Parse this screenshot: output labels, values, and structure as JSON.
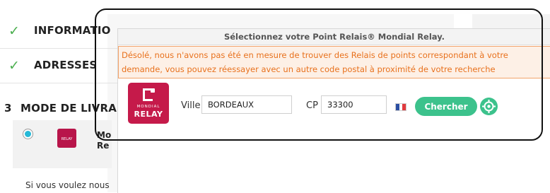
{
  "steps": [
    {
      "title": "INFORMATIO",
      "done": true
    },
    {
      "title": "ADRESSES",
      "done": true
    },
    {
      "number": "3",
      "title": "MODE DE LIVRA"
    }
  ],
  "carrier": {
    "name_line1": "Mo",
    "name_line2": "Re",
    "logo_text": "RELAY"
  },
  "shipping_note": "Si vous voulez nous",
  "modal": {
    "title": "Sélectionnez votre Point Relais® Mondial Relay.",
    "error": "Désolé, nous n'avons pas été en mesure de trouver des Relais de points correspondant à votre demande, vous pouvez réessayer avec un autre code postal à proximité de votre recherche",
    "logo": {
      "top": "MONDIAL",
      "bottom": "RELAY"
    },
    "city_label": "Ville",
    "city_value": "BORDEAUX",
    "zip_label": "CP",
    "zip_value": "33300",
    "search_label": "Chercher",
    "colors": {
      "accent": "#3cc28c",
      "brand": "#c51a4a",
      "error": "#e8711d"
    }
  }
}
